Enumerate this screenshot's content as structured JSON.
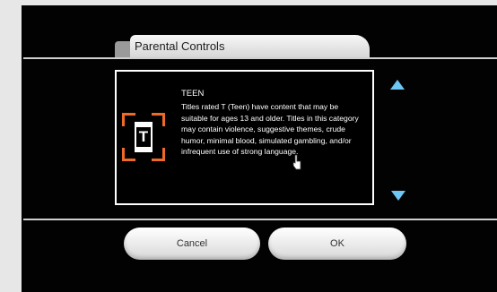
{
  "dialog": {
    "title": "Parental Controls",
    "rating_name": "TEEN",
    "rating_description": "Titles rated T (Teen) have content that may be suitable for ages 13 and older. Titles in this category may contain violence, suggestive themes, crude humor, minimal blood, simulated gambling, and/or infrequent use of strong language.",
    "rating_icon_letter": "T",
    "accent_color": "#ee6a2b",
    "arrow_color": "#6ec6f3"
  },
  "buttons": {
    "cancel_label": "Cancel",
    "ok_label": "OK"
  }
}
